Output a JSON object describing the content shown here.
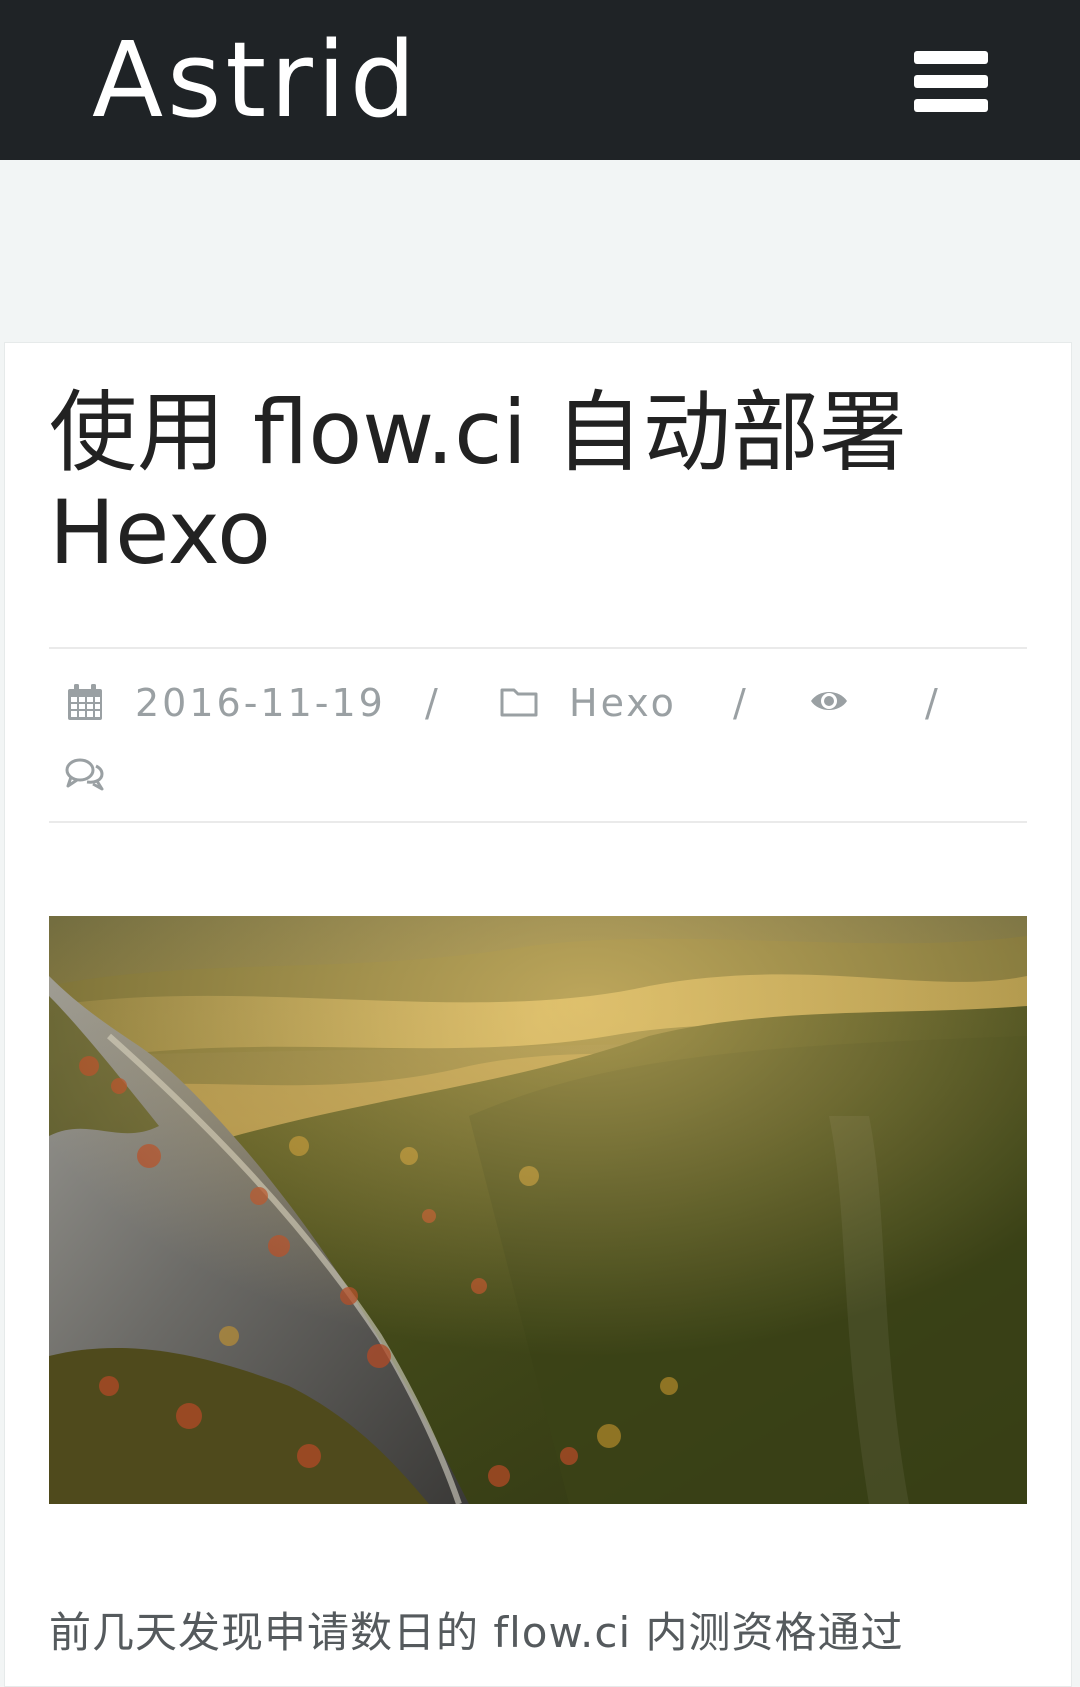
{
  "header": {
    "site_title": "Astrid",
    "menu_icon": "hamburger-menu-icon"
  },
  "post": {
    "title": "使用 flow.ci 自动部署 Hexo",
    "meta": {
      "date_icon": "calendar-icon",
      "date": "2016-11-19",
      "separator": "/",
      "category_icon": "folder-icon",
      "category": "Hexo",
      "views_icon": "eye-icon",
      "comments_icon": "comments-icon"
    },
    "cover_image": "mountain-forest-landscape-photo",
    "excerpt": "前几天发现申请数日的 flow.ci 内测资格通过"
  },
  "colors": {
    "header_bg": "#1f2326",
    "page_bg": "#f2f5f5",
    "card_bg": "#ffffff",
    "title_text": "#222222",
    "meta_text": "#9aa0a3",
    "body_text": "#555a5d"
  }
}
